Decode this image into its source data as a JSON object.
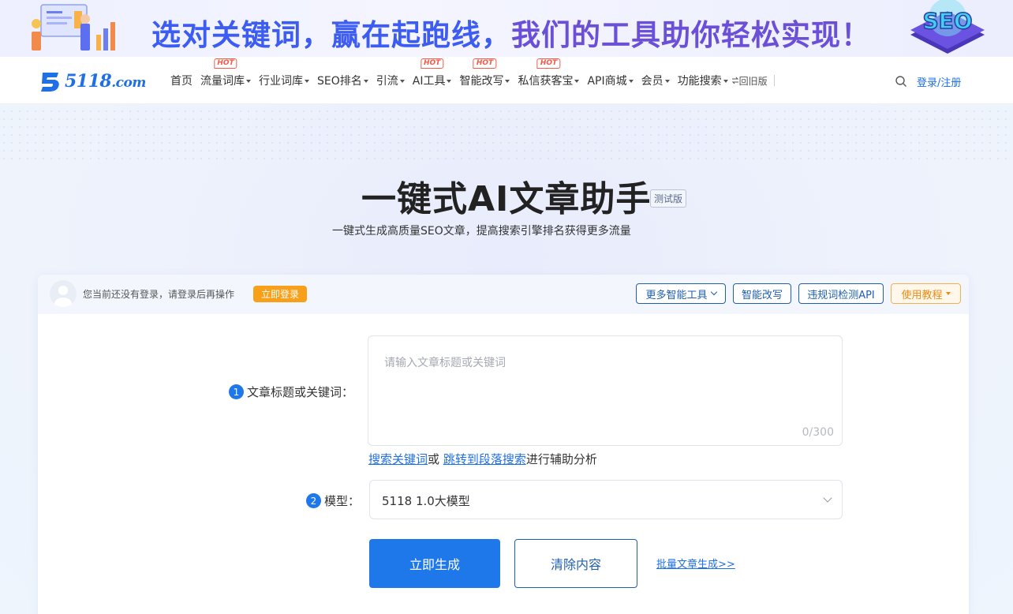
{
  "banner": {
    "headline_part1": "选对关键词，赢在起跑线，",
    "headline_part2": "我们的工具助你轻松实现！",
    "seo_badge": "SEO"
  },
  "logo": {
    "brand": "5118",
    "suffix": ".com"
  },
  "nav": {
    "items": [
      {
        "label": "首页",
        "caret": false,
        "hot": ""
      },
      {
        "label": "流量词库",
        "caret": true,
        "hot": "HOT"
      },
      {
        "label": "行业词库",
        "caret": true,
        "hot": ""
      },
      {
        "label": "SEO排名",
        "caret": true,
        "hot": ""
      },
      {
        "label": "引流",
        "caret": true,
        "hot": ""
      },
      {
        "label": "AI工具",
        "caret": true,
        "hot": "HOT"
      },
      {
        "label": "智能改写",
        "caret": true,
        "hot": "HOT"
      },
      {
        "label": "私信获客宝",
        "caret": true,
        "hot": "HOT"
      },
      {
        "label": "API商城",
        "caret": true,
        "hot": ""
      },
      {
        "label": "会员",
        "caret": true,
        "hot": ""
      },
      {
        "label": "功能搜索",
        "caret": true,
        "hot": ""
      }
    ],
    "old_version": "回旧版",
    "old_version_icon": "swap-icon",
    "login": "登录/注册"
  },
  "hero": {
    "title": "一键式AI文章助手",
    "beta": "测试版",
    "subtitle": "一键式生成高质量SEO文章，提高搜索引擎排名获得更多流量"
  },
  "card": {
    "notice": "您当前还没有登录，请登录后再操作",
    "login_now": "立即登录",
    "more_tools": "更多智能工具",
    "rewrite": "智能改写",
    "violation_api": "违规词检测API",
    "tutorial": "使用教程",
    "step1_num": "1",
    "step1_label": "文章标题或关键词：",
    "input_placeholder": "请输入文章标题或关键词",
    "counter": "0/300",
    "helper_link1": "搜索关键词",
    "helper_or": "或",
    "helper_link2": "跳转到段落搜索",
    "helper_tail": "进行辅助分析",
    "step2_num": "2",
    "step2_label": "模型：",
    "model_selected": "5118 1.0大模型",
    "generate": "立即生成",
    "clear": "清除内容",
    "batch": "批量文章生成>>"
  },
  "colors": {
    "primary": "#1f78ea",
    "orange": "#f8a019",
    "hot_red": "#f55b4b",
    "nav_blue": "#1f5fae"
  }
}
